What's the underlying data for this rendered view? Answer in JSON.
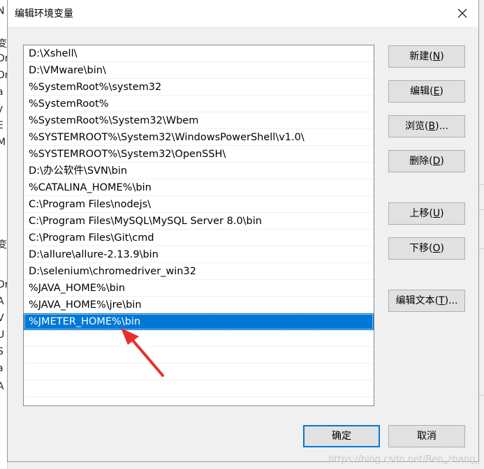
{
  "dialog": {
    "title": "编辑环境变量",
    "close_icon": "close-icon"
  },
  "background": {
    "left_fragments": [
      "N",
      "变",
      "Dr",
      "Dr",
      "a",
      "y",
      "E",
      "M",
      "变",
      "Dr",
      "A",
      "V",
      "U",
      "S",
      "a",
      "A"
    ]
  },
  "paths": {
    "items": [
      "D:\\Xshell\\",
      "D:\\VMware\\bin\\",
      "%SystemRoot%\\system32",
      "%SystemRoot%",
      "%SystemRoot%\\System32\\Wbem",
      "%SYSTEMROOT%\\System32\\WindowsPowerShell\\v1.0\\",
      "%SYSTEMROOT%\\System32\\OpenSSH\\",
      "D:\\办公软件\\SVN\\bin",
      "%CATALINA_HOME%\\bin",
      "C:\\Program Files\\nodejs\\",
      "C:\\Program Files\\MySQL\\MySQL Server 8.0\\bin",
      "C:\\Program Files\\Git\\cmd",
      "D:\\allure\\allure-2.13.9\\bin",
      "D:\\selenium\\chromedriver_win32",
      "%JAVA_HOME%\\bin",
      "%JAVA_HOME%\\jre\\bin",
      "%JMETER_HOME%\\bin"
    ],
    "selected_index": 16,
    "empty_rows": 5
  },
  "buttons": {
    "new": {
      "label": "新建(",
      "key": "N",
      "tail": ")"
    },
    "edit": {
      "label": "编辑(",
      "key": "E",
      "tail": ")"
    },
    "browse": {
      "label": "浏览(",
      "key": "B",
      "tail": ")..."
    },
    "delete": {
      "label": "删除(",
      "key": "D",
      "tail": ")"
    },
    "move_up": {
      "label": "上移(",
      "key": "U",
      "tail": ")"
    },
    "move_down": {
      "label": "下移(",
      "key": "O",
      "tail": ")"
    },
    "edit_text": {
      "label": "编辑文本(",
      "key": "T",
      "tail": ")..."
    },
    "ok": "确定",
    "cancel": "取消"
  },
  "watermark": "https://blog.csdn.net/Ben_zhang_",
  "colors": {
    "selection": "#0078d7",
    "annotation_arrow": "#e8302a"
  }
}
